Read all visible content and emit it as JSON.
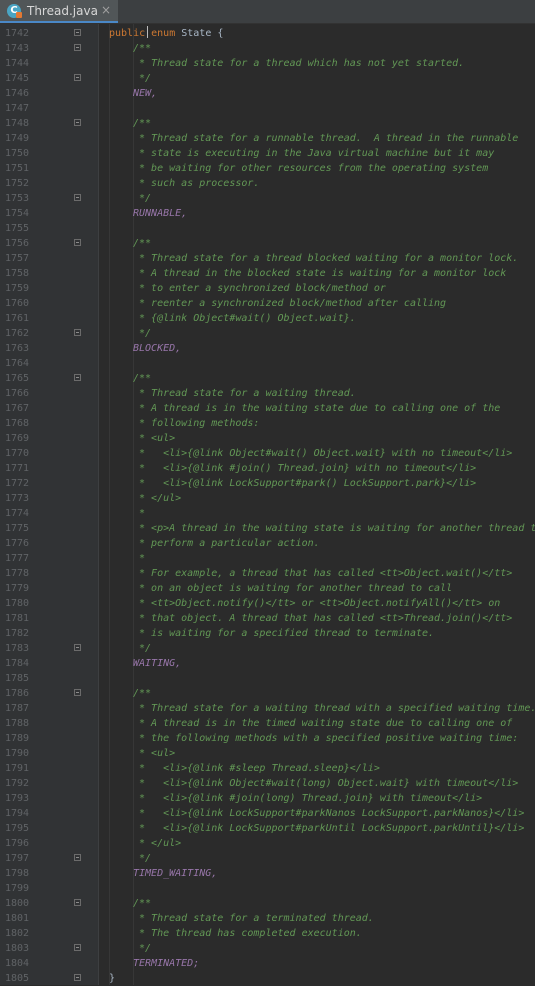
{
  "tab": {
    "title": "Thread.java",
    "close": "×",
    "icon_letter": "C"
  },
  "colors": {
    "keyword": "#cc7832",
    "text": "#a9b7c6",
    "constant": "#9876aa",
    "javadoc": "#629755",
    "line_number": "#606366",
    "background": "#2b2b2b"
  },
  "lines": [
    {
      "n": "1742",
      "fold": true,
      "t": "code",
      "s": "public enum State {"
    },
    {
      "n": "1743",
      "fold": true,
      "t": "doc",
      "s": "/**"
    },
    {
      "n": "1744",
      "fold": false,
      "t": "doc",
      "s": " * Thread state for a thread which has not yet started."
    },
    {
      "n": "1745",
      "fold": true,
      "t": "doc",
      "s": " */"
    },
    {
      "n": "1746",
      "fold": false,
      "t": "const",
      "s": "NEW,"
    },
    {
      "n": "1747",
      "fold": false,
      "t": "blank",
      "s": ""
    },
    {
      "n": "1748",
      "fold": true,
      "t": "doc",
      "s": "/**"
    },
    {
      "n": "1749",
      "fold": false,
      "t": "doc",
      "s": " * Thread state for a runnable thread.  A thread in the runnable"
    },
    {
      "n": "1750",
      "fold": false,
      "t": "doc",
      "s": " * state is executing in the Java virtual machine but it may"
    },
    {
      "n": "1751",
      "fold": false,
      "t": "doc",
      "s": " * be waiting for other resources from the operating system"
    },
    {
      "n": "1752",
      "fold": false,
      "t": "doc",
      "s": " * such as processor."
    },
    {
      "n": "1753",
      "fold": true,
      "t": "doc",
      "s": " */"
    },
    {
      "n": "1754",
      "fold": false,
      "t": "const",
      "s": "RUNNABLE,"
    },
    {
      "n": "1755",
      "fold": false,
      "t": "blank",
      "s": ""
    },
    {
      "n": "1756",
      "fold": true,
      "t": "doc",
      "s": "/**"
    },
    {
      "n": "1757",
      "fold": false,
      "t": "doc",
      "s": " * Thread state for a thread blocked waiting for a monitor lock."
    },
    {
      "n": "1758",
      "fold": false,
      "t": "doc",
      "s": " * A thread in the blocked state is waiting for a monitor lock"
    },
    {
      "n": "1759",
      "fold": false,
      "t": "doc",
      "s": " * to enter a synchronized block/method or"
    },
    {
      "n": "1760",
      "fold": false,
      "t": "doc",
      "s": " * reenter a synchronized block/method after calling"
    },
    {
      "n": "1761",
      "fold": false,
      "t": "doc",
      "s": " * {@link Object#wait() Object.wait}."
    },
    {
      "n": "1762",
      "fold": true,
      "t": "doc",
      "s": " */"
    },
    {
      "n": "1763",
      "fold": false,
      "t": "const",
      "s": "BLOCKED,"
    },
    {
      "n": "1764",
      "fold": false,
      "t": "blank",
      "s": ""
    },
    {
      "n": "1765",
      "fold": true,
      "t": "doc",
      "s": "/**"
    },
    {
      "n": "1766",
      "fold": false,
      "t": "doc",
      "s": " * Thread state for a waiting thread."
    },
    {
      "n": "1767",
      "fold": false,
      "t": "doc",
      "s": " * A thread is in the waiting state due to calling one of the"
    },
    {
      "n": "1768",
      "fold": false,
      "t": "doc",
      "s": " * following methods:"
    },
    {
      "n": "1769",
      "fold": false,
      "t": "doc",
      "s": " * <ul>"
    },
    {
      "n": "1770",
      "fold": false,
      "t": "doc",
      "s": " *   <li>{@link Object#wait() Object.wait} with no timeout</li>"
    },
    {
      "n": "1771",
      "fold": false,
      "t": "doc",
      "s": " *   <li>{@link #join() Thread.join} with no timeout</li>"
    },
    {
      "n": "1772",
      "fold": false,
      "t": "doc",
      "s": " *   <li>{@link LockSupport#park() LockSupport.park}</li>"
    },
    {
      "n": "1773",
      "fold": false,
      "t": "doc",
      "s": " * </ul>"
    },
    {
      "n": "1774",
      "fold": false,
      "t": "doc",
      "s": " *"
    },
    {
      "n": "1775",
      "fold": false,
      "t": "doc",
      "s": " * <p>A thread in the waiting state is waiting for another thread to"
    },
    {
      "n": "1776",
      "fold": false,
      "t": "doc",
      "s": " * perform a particular action."
    },
    {
      "n": "1777",
      "fold": false,
      "t": "doc",
      "s": " *"
    },
    {
      "n": "1778",
      "fold": false,
      "t": "doc",
      "s": " * For example, a thread that has called <tt>Object.wait()</tt>"
    },
    {
      "n": "1779",
      "fold": false,
      "t": "doc",
      "s": " * on an object is waiting for another thread to call"
    },
    {
      "n": "1780",
      "fold": false,
      "t": "doc",
      "s": " * <tt>Object.notify()</tt> or <tt>Object.notifyAll()</tt> on"
    },
    {
      "n": "1781",
      "fold": false,
      "t": "doc",
      "s": " * that object. A thread that has called <tt>Thread.join()</tt>"
    },
    {
      "n": "1782",
      "fold": false,
      "t": "doc",
      "s": " * is waiting for a specified thread to terminate."
    },
    {
      "n": "1783",
      "fold": true,
      "t": "doc",
      "s": " */"
    },
    {
      "n": "1784",
      "fold": false,
      "t": "const",
      "s": "WAITING,"
    },
    {
      "n": "1785",
      "fold": false,
      "t": "blank",
      "s": ""
    },
    {
      "n": "1786",
      "fold": true,
      "t": "doc",
      "s": "/**"
    },
    {
      "n": "1787",
      "fold": false,
      "t": "doc",
      "s": " * Thread state for a waiting thread with a specified waiting time."
    },
    {
      "n": "1788",
      "fold": false,
      "t": "doc",
      "s": " * A thread is in the timed waiting state due to calling one of"
    },
    {
      "n": "1789",
      "fold": false,
      "t": "doc",
      "s": " * the following methods with a specified positive waiting time:"
    },
    {
      "n": "1790",
      "fold": false,
      "t": "doc",
      "s": " * <ul>"
    },
    {
      "n": "1791",
      "fold": false,
      "t": "doc",
      "s": " *   <li>{@link #sleep Thread.sleep}</li>"
    },
    {
      "n": "1792",
      "fold": false,
      "t": "doc",
      "s": " *   <li>{@link Object#wait(long) Object.wait} with timeout</li>"
    },
    {
      "n": "1793",
      "fold": false,
      "t": "doc",
      "s": " *   <li>{@link #join(long) Thread.join} with timeout</li>"
    },
    {
      "n": "1794",
      "fold": false,
      "t": "doc",
      "s": " *   <li>{@link LockSupport#parkNanos LockSupport.parkNanos}</li>"
    },
    {
      "n": "1795",
      "fold": false,
      "t": "doc",
      "s": " *   <li>{@link LockSupport#parkUntil LockSupport.parkUntil}</li>"
    },
    {
      "n": "1796",
      "fold": false,
      "t": "doc",
      "s": " * </ul>"
    },
    {
      "n": "1797",
      "fold": true,
      "t": "doc",
      "s": " */"
    },
    {
      "n": "1798",
      "fold": false,
      "t": "const",
      "s": "TIMED_WAITING,"
    },
    {
      "n": "1799",
      "fold": false,
      "t": "blank",
      "s": ""
    },
    {
      "n": "1800",
      "fold": true,
      "t": "doc",
      "s": "/**"
    },
    {
      "n": "1801",
      "fold": false,
      "t": "doc",
      "s": " * Thread state for a terminated thread."
    },
    {
      "n": "1802",
      "fold": false,
      "t": "doc",
      "s": " * The thread has completed execution."
    },
    {
      "n": "1803",
      "fold": true,
      "t": "doc",
      "s": " */"
    },
    {
      "n": "1804",
      "fold": false,
      "t": "const",
      "s": "TERMINATED;"
    },
    {
      "n": "1805",
      "fold": true,
      "t": "code",
      "s": "}"
    }
  ]
}
